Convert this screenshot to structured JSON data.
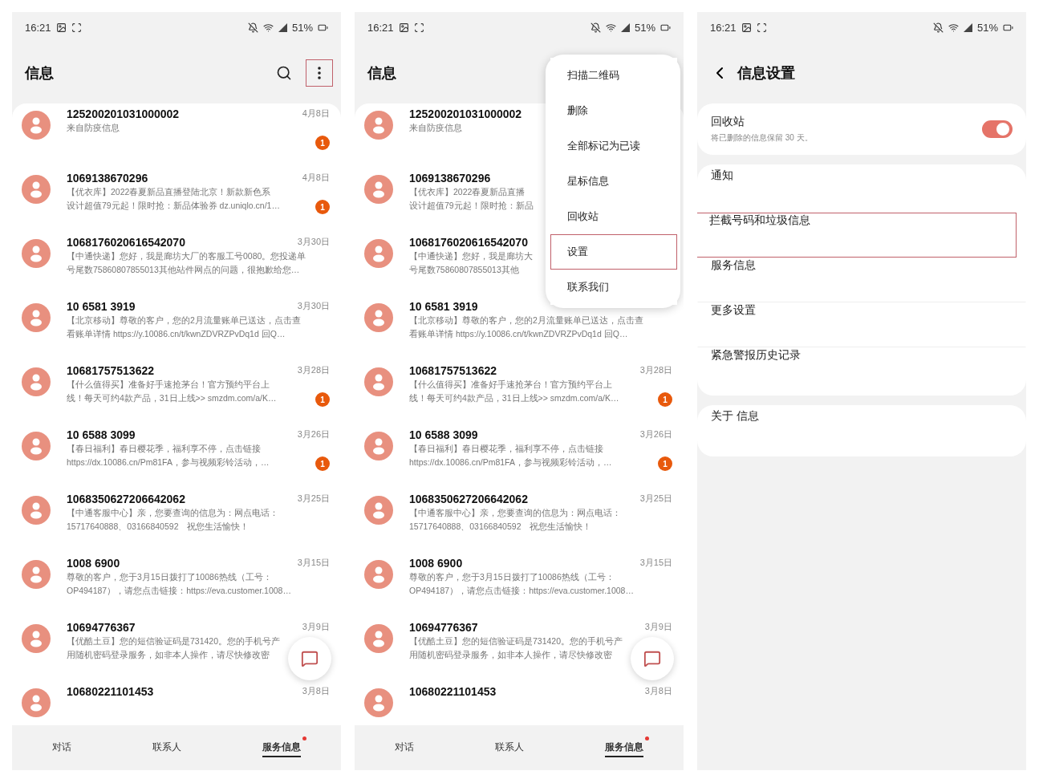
{
  "panels": [
    {
      "kind": "list",
      "status": {
        "time": "16:21",
        "battery": "51%"
      },
      "title": "信息",
      "actions": [
        {
          "kind": "search",
          "highlighted": false
        },
        {
          "kind": "more",
          "highlighted": true
        }
      ],
      "conversations": [
        {
          "name": "125200201031000002",
          "date": "4月8日",
          "lines": [
            "来自防疫信息"
          ],
          "unread": "1"
        },
        {
          "name": "1069138670296",
          "date": "4月8日",
          "lines": [
            "【优衣库】2022春夏新品直播登陆北京！新款新色系",
            "设计超值79元起！限时抢：新品体验券 dz.uniqlo.cn/1…"
          ],
          "unread": "1"
        },
        {
          "name": "1068176020616542070",
          "date": "3月30日",
          "lines": [
            "【中通快递】您好，我是廊坊大厂的客服工号0080。您投递单",
            "号尾数75860807855013其他站件网点的问题，很抱歉给您…"
          ]
        },
        {
          "name": "10 6581 3919",
          "date": "3月30日",
          "lines": [
            "【北京移动】尊敬的客户，您的2月流量账单已送达，点击查",
            "看账单详情 https://y.10086.cn/t/kwnZDVRZPvDq1d 回Q…"
          ]
        },
        {
          "name": "10681757513622",
          "date": "3月28日",
          "lines": [
            "【什么值得买】准备好手速抢茅台！官方预约平台上",
            "线！每天可约4款产品，31日上线>> smzdm.com/a/K…"
          ],
          "unread": "1"
        },
        {
          "name": "10 6588 3099",
          "date": "3月26日",
          "lines": [
            "【春日福利】春日樱花季，福利享不停，点击链接",
            "https://dx.10086.cn/Pm81FA，参与视频彩铃活动，…"
          ],
          "unread": "1"
        },
        {
          "name": "1068350627206642062",
          "date": "3月25日",
          "lines": [
            "【中通客服中心】亲，您要查询的信息为：网点电话：",
            "15717640888、03166840592　祝您生活愉快！"
          ]
        },
        {
          "name": "1008 6900",
          "date": "3月15日",
          "lines": [
            "尊敬的客户，您于3月15日拨打了10086热线（工号：",
            "OP494187），请您点击链接：https://eva.customer.1008…"
          ]
        },
        {
          "name": "10694776367",
          "date": "3月9日",
          "lines": [
            "【优酷土豆】您的短信验证码是731420。您的手机号产",
            "用随机密码登录服务，如非本人操作，请尽快修改密"
          ]
        },
        {
          "name": "10680221101453",
          "date": "3月8日"
        }
      ],
      "tabs": [
        {
          "label": "对话",
          "selected": false,
          "dot": false
        },
        {
          "label": "联系人",
          "selected": false,
          "dot": false
        },
        {
          "label": "服务信息",
          "selected": true,
          "dot": true
        }
      ]
    },
    {
      "kind": "list",
      "status": {
        "time": "16:21",
        "battery": "51%"
      },
      "title": "信息",
      "conversations": [
        {
          "name": "125200201031000002",
          "lines": [
            "来自防疫信息"
          ]
        },
        {
          "name": "1069138670296",
          "lines": [
            "【优衣库】2022春夏新品直播",
            "设计超值79元起！限时抢：新品"
          ]
        },
        {
          "name": "1068176020616542070",
          "lines": [
            "【中通快递】您好，我是廊坊大",
            "号尾数75860807855013其他"
          ]
        },
        {
          "name": "10 6581 3919",
          "lines": [
            "【北京移动】尊敬的客户，您的2月流量账单已送达，点击查",
            "看账单详情 https://y.10086.cn/t/kwnZDVRZPvDq1d 回Q…"
          ]
        },
        {
          "name": "10681757513622",
          "date": "3月28日",
          "lines": [
            "【什么值得买】准备好手速抢茅台！官方预约平台上",
            "线！每天可约4款产品，31日上线>> smzdm.com/a/K…"
          ],
          "unread": "1"
        },
        {
          "name": "10 6588 3099",
          "date": "3月26日",
          "lines": [
            "【春日福利】春日樱花季，福利享不停，点击链接",
            "https://dx.10086.cn/Pm81FA，参与视频彩铃活动，…"
          ],
          "unread": "1"
        },
        {
          "name": "1068350627206642062",
          "date": "3月25日",
          "lines": [
            "【中通客服中心】亲，您要查询的信息为：网点电话：",
            "15717640888、03166840592　祝您生活愉快！"
          ]
        },
        {
          "name": "1008 6900",
          "date": "3月15日",
          "lines": [
            "尊敬的客户，您于3月15日拨打了10086热线（工号：",
            "OP494187），请您点击链接：https://eva.customer.1008…"
          ]
        },
        {
          "name": "10694776367",
          "date": "3月9日",
          "lines": [
            "【优酷土豆】您的短信验证码是731420。您的手机号产",
            "用随机密码登录服务，如非本人操作，请尽快修改密"
          ]
        },
        {
          "name": "10680221101453",
          "date": "3月8日"
        }
      ],
      "menu": {
        "items": [
          {
            "label": "扫描二维码",
            "highlighted": false
          },
          {
            "label": "删除",
            "highlighted": false
          },
          {
            "label": "全部标记为已读",
            "highlighted": false
          },
          {
            "label": "星标信息",
            "highlighted": false
          },
          {
            "label": "回收站",
            "highlighted": false
          },
          {
            "label": "设置",
            "highlighted": true
          },
          {
            "label": "联系我们",
            "highlighted": false
          }
        ]
      },
      "tabs": [
        {
          "label": "对话",
          "selected": false,
          "dot": false
        },
        {
          "label": "联系人",
          "selected": false,
          "dot": false
        },
        {
          "label": "服务信息",
          "selected": true,
          "dot": true
        }
      ]
    },
    {
      "kind": "settings",
      "status": {
        "time": "16:21",
        "battery": "51%"
      },
      "title": "信息设置",
      "groups": [
        {
          "items": [
            {
              "kind": "toggle",
              "label": "回收站",
              "sub": "将已删除的信息保留 30 天。",
              "on": true,
              "highlighted": false
            }
          ]
        },
        {
          "items": [
            {
              "kind": "link",
              "label": "通知",
              "highlighted": false
            },
            {
              "kind": "link",
              "label": "拦截号码和垃圾信息",
              "highlighted": true
            },
            {
              "kind": "link",
              "label": "服务信息",
              "highlighted": false
            },
            {
              "kind": "link",
              "label": "更多设置",
              "highlighted": false
            },
            {
              "kind": "link",
              "label": "紧急警报历史记录",
              "highlighted": false
            }
          ]
        },
        {
          "items": [
            {
              "kind": "link",
              "label": "关于 信息",
              "highlighted": false
            }
          ]
        }
      ]
    }
  ]
}
